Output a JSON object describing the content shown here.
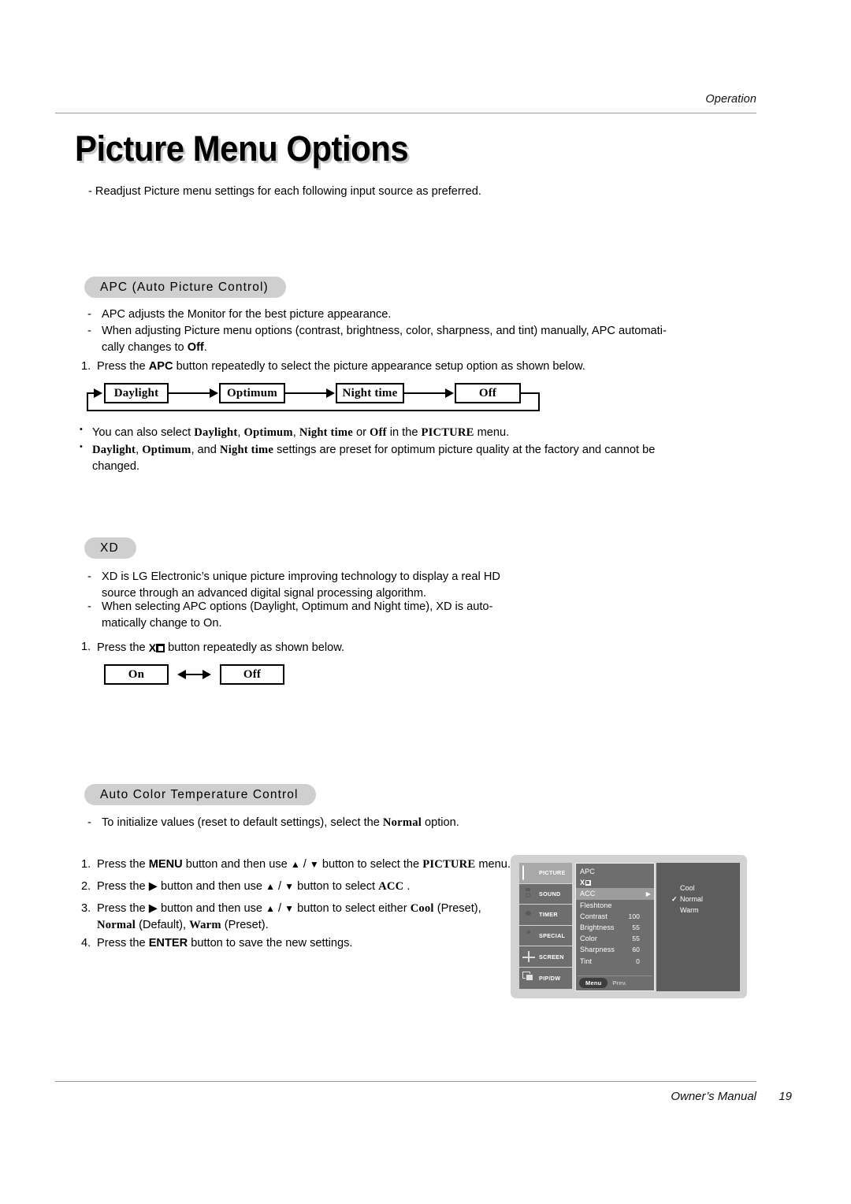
{
  "header": {
    "section_label": "Operation"
  },
  "title": "Picture Menu Options",
  "intro": "- Readjust Picture menu settings for each following input source as preferred.",
  "sections": {
    "apc": {
      "heading": "APC (Auto Picture Control)",
      "dash_1": "APC adjusts the Monitor for the best picture appearance.",
      "dash_2_a": "When adjusting Picture menu options (contrast, brightness, color, sharpness, and tint) manually, APC automati-",
      "dash_2_b_pre": "cally changes to ",
      "dash_2_b_bold": "Off",
      "dash_2_b_post": ".",
      "step_1_num": "1.",
      "step_1_pre": "Press the ",
      "step_1_bold": "APC",
      "step_1_post": " button repeatedly to select the picture appearance setup option as shown below.",
      "flow": [
        "Daylight",
        "Optimum",
        "Night time",
        "Off"
      ],
      "bullet_1": {
        "pre": "You can also select ",
        "b1": "Daylight",
        "s1": ", ",
        "b2": "Optimum",
        "s2": ", ",
        "b3": "Night time",
        "s3": " or ",
        "b4": "Off",
        "s4": " in the ",
        "b5": "PICTURE",
        "post": " menu."
      },
      "bullet_2": {
        "b1": "Daylight",
        "s1": ", ",
        "b2": "Optimum",
        "s2": ", and ",
        "b3": "Night time",
        "post": " settings are preset for optimum picture quality at the factory and cannot be",
        "line2": "changed."
      }
    },
    "xd": {
      "heading": "XD",
      "dash_1_a": "XD is LG Electronic’s unique picture improving technology to display a real HD",
      "dash_1_b": "source through an advanced digital signal processing algorithm.",
      "dash_2_a": "When selecting APC options (Daylight, Optimum and Night time), XD is auto-",
      "dash_2_b": "matically change to On.",
      "step_1_num": "1.",
      "step_1_pre": "Press the ",
      "step_1_glyph": "XD",
      "step_1_post": " button repeatedly as shown below.",
      "flow": [
        "On",
        "Off"
      ]
    },
    "acct": {
      "heading": "Auto Color Temperature Control",
      "dash_1_pre": "To initialize values (reset to default settings), select the ",
      "dash_1_bold": "Normal",
      "dash_1_post": " option.",
      "steps": [
        {
          "num": "1.",
          "p1": "Press the ",
          "b1": "MENU",
          "p2": " button and then use ",
          "p3": " button to select the ",
          "b2": "PICTURE",
          "p4": " menu."
        },
        {
          "num": "2.",
          "p1": "Press the ",
          "p2": " button and then use ",
          "p3": " button to select ",
          "b1": "ACC",
          "p4": " ."
        },
        {
          "num": "3.",
          "p1": "Press the ",
          "p2": " button and then use ",
          "p3": " button to select either ",
          "b1": "Cool",
          "p4": " (Preset),",
          "l2_b1": "Normal",
          "l2_p1": " (Default), ",
          "l2_b2": "Warm",
          "l2_p2": " (Preset)."
        },
        {
          "num": "4.",
          "p1": "Press the ",
          "b1": "ENTER",
          "p2": " button to save the new settings."
        }
      ]
    }
  },
  "osd": {
    "sidebar": [
      {
        "label": "PICTURE",
        "icon": "tv-screen-icon",
        "active": true
      },
      {
        "label": "SOUND",
        "icon": "speaker-icon",
        "active": false
      },
      {
        "label": "TIMER",
        "icon": "clock-icon",
        "active": false
      },
      {
        "label": "SPECIAL",
        "icon": "remote-control-icon",
        "active": false
      },
      {
        "label": "SCREEN",
        "icon": "crosshair-icon",
        "active": false
      },
      {
        "label": "PIP/DW",
        "icon": "picture-in-picture-icon",
        "active": false
      }
    ],
    "menu": [
      {
        "label": "APC",
        "value": "",
        "selected": false,
        "arrow": false
      },
      {
        "label": "XD",
        "value": "",
        "selected": false,
        "arrow": false,
        "glyph": "xd-logo"
      },
      {
        "label": "ACC",
        "value": "",
        "selected": true,
        "arrow": true
      },
      {
        "label": "Fleshtone",
        "value": "",
        "selected": false,
        "arrow": false
      },
      {
        "label": "Contrast",
        "value": "100",
        "selected": false,
        "arrow": false
      },
      {
        "label": "Brightness",
        "value": "55",
        "selected": false,
        "arrow": false
      },
      {
        "label": "Color",
        "value": "55",
        "selected": false,
        "arrow": false
      },
      {
        "label": "Sharpness",
        "value": "60",
        "selected": false,
        "arrow": false
      },
      {
        "label": "Tint",
        "value": "0",
        "selected": false,
        "arrow": false
      }
    ],
    "menu_bar": {
      "menu_label": "Menu",
      "prev_label": "Prev."
    },
    "options": [
      {
        "label": "Cool",
        "checked": false
      },
      {
        "label": "Normal",
        "checked": true
      },
      {
        "label": "Warm",
        "checked": false
      }
    ],
    "check_glyph": "✓"
  },
  "footer": {
    "manual_label": "Owner’s Manual",
    "page_number": "19"
  },
  "colors": {
    "pill_bg": "#cfcfcf",
    "osd_frame": "#d2d2d2",
    "osd_panel": "#6e6e6e",
    "osd_selected": "#9d9d9d",
    "osd_right": "#5d5d5d",
    "rule": "#9a9a9a"
  }
}
